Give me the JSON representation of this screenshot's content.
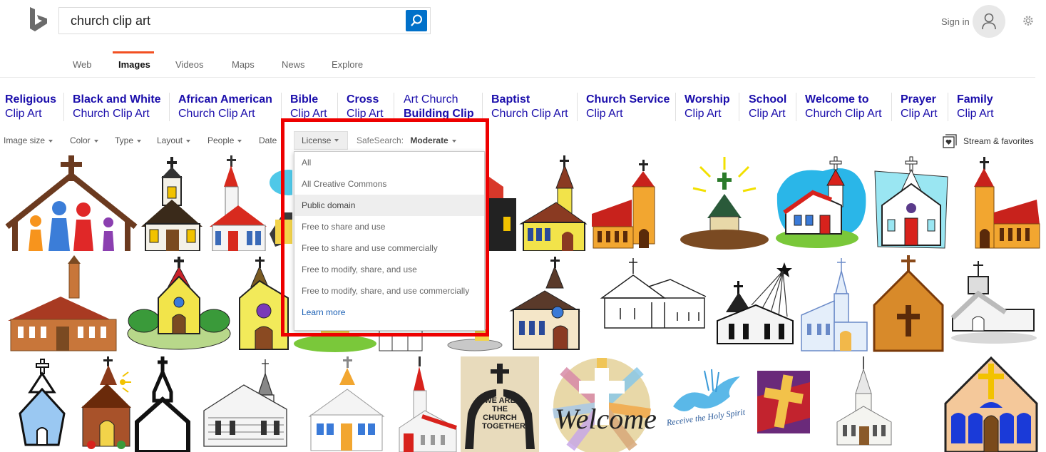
{
  "search": {
    "query": "church clip art"
  },
  "header": {
    "sign_in": "Sign in"
  },
  "tabs": [
    {
      "label": "Web"
    },
    {
      "label": "Images"
    },
    {
      "label": "Videos"
    },
    {
      "label": "Maps"
    },
    {
      "label": "News"
    },
    {
      "label": "Explore"
    }
  ],
  "related": [
    {
      "l1": "Religious",
      "l2": "Clip Art"
    },
    {
      "l1": "Black and White",
      "l2": "Church Clip Art"
    },
    {
      "l1": "African American",
      "l2": "Church Clip Art"
    },
    {
      "l1": "Bible",
      "l2": "Clip Art"
    },
    {
      "l1": "Cross",
      "l2": "Clip Art"
    },
    {
      "l1": "Art Church",
      "l2": "Building Clip"
    },
    {
      "l1": "Baptist",
      "l2": "Church Clip Art"
    },
    {
      "l1": "Church Service",
      "l2": "Clip Art"
    },
    {
      "l1": "Worship",
      "l2": "Clip Art"
    },
    {
      "l1": "School",
      "l2": "Clip Art"
    },
    {
      "l1": "Welcome to",
      "l2": "Church Clip Art"
    },
    {
      "l1": "Prayer",
      "l2": "Clip Art"
    },
    {
      "l1": "Family",
      "l2": "Clip Art"
    }
  ],
  "filters": {
    "image_size": "Image size",
    "color": "Color",
    "type": "Type",
    "layout": "Layout",
    "people": "People",
    "date": "Date",
    "license": "License",
    "safesearch_label": "SafeSearch:",
    "safesearch_value": "Moderate",
    "stream": "Stream & favorites"
  },
  "license_options": [
    {
      "label": "All"
    },
    {
      "label": "All Creative Commons"
    },
    {
      "label": "Public domain",
      "selected": true
    },
    {
      "label": "Free to share and use"
    },
    {
      "label": "Free to share and use commercially"
    },
    {
      "label": "Free to modify, share, and use"
    },
    {
      "label": "Free to modify, share, and use commercially"
    },
    {
      "label": "Learn more"
    }
  ],
  "thumb_text": {
    "we_are": "WE ARE THE CHURCH TOGETHER",
    "welcome": "Welcome",
    "receive": "Receive the Holy Spirit"
  },
  "colors": {
    "accent": "#f25022",
    "link": "#1a0dab",
    "search_button": "#0070c9",
    "highlight": "#ee0000"
  }
}
